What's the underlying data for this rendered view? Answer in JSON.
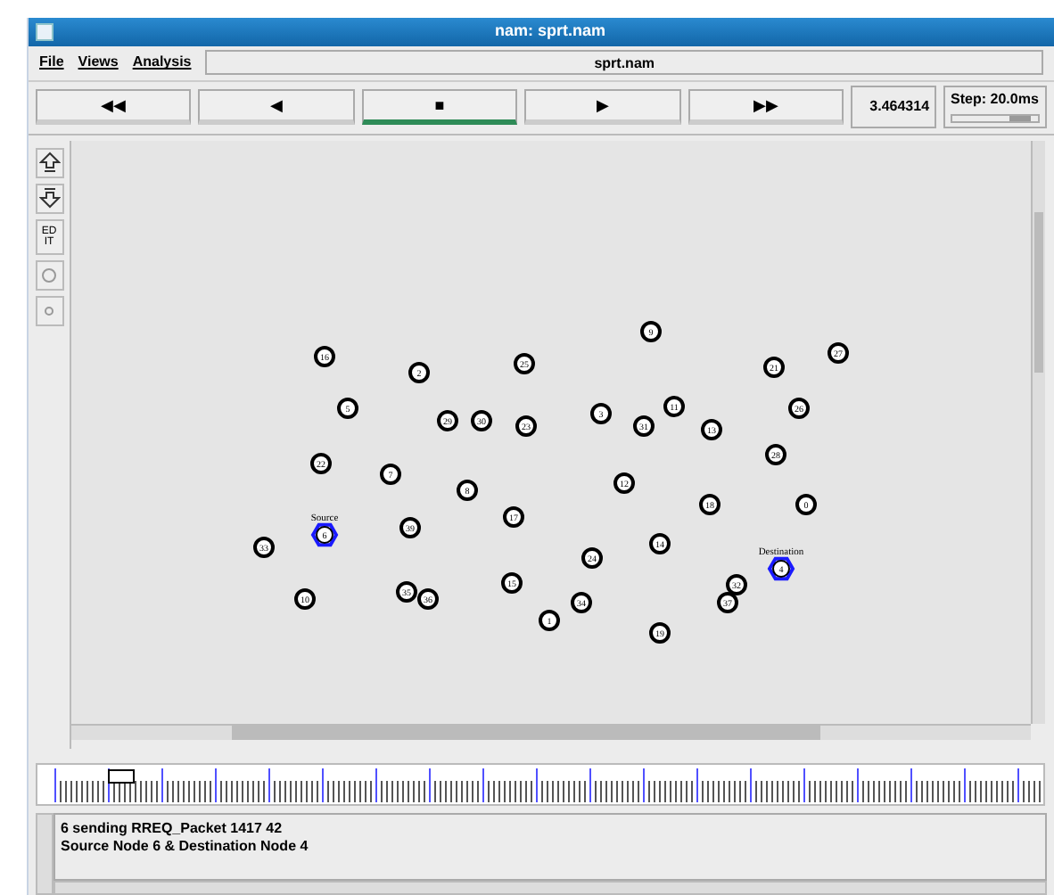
{
  "window": {
    "title": "nam: sprt.nam"
  },
  "menu": [
    "File",
    "Views",
    "Analysis"
  ],
  "file_name": "sprt.nam",
  "playback": [
    {
      "symbol": "◀◀",
      "selected": false
    },
    {
      "symbol": "◀",
      "selected": false
    },
    {
      "symbol": "■",
      "selected": true
    },
    {
      "symbol": "▶",
      "selected": false
    },
    {
      "symbol": "▶▶",
      "selected": false
    }
  ],
  "time": "3.464314",
  "step": {
    "label": "Step: 20.0ms",
    "level": 0.8
  },
  "tools": [
    {
      "kind": "zoom-in"
    },
    {
      "kind": "zoom-out"
    },
    {
      "kind": "edit",
      "text": "ED IT"
    },
    {
      "kind": "circle"
    },
    {
      "kind": "dot"
    }
  ],
  "nodes": [
    {
      "label": "16",
      "kind": "node"
    },
    {
      "label": "2",
      "kind": "node"
    },
    {
      "label": "25",
      "kind": "node"
    },
    {
      "label": "9",
      "kind": "node"
    },
    {
      "label": "21",
      "kind": "node"
    },
    {
      "label": "27",
      "kind": "node"
    },
    {
      "label": "5",
      "kind": "node"
    },
    {
      "label": "29",
      "kind": "node"
    },
    {
      "label": "30",
      "kind": "node"
    },
    {
      "label": "23",
      "kind": "node"
    },
    {
      "label": "3",
      "kind": "node"
    },
    {
      "label": "31",
      "kind": "node"
    },
    {
      "label": "11",
      "kind": "node"
    },
    {
      "label": "13",
      "kind": "node"
    },
    {
      "label": "26",
      "kind": "node"
    },
    {
      "label": "22",
      "kind": "node"
    },
    {
      "label": "7",
      "kind": "node"
    },
    {
      "label": "8",
      "kind": "node"
    },
    {
      "label": "12",
      "kind": "node"
    },
    {
      "label": "28",
      "kind": "node"
    },
    {
      "label": "18",
      "kind": "node"
    },
    {
      "label": "0",
      "kind": "node"
    },
    {
      "label": "17",
      "kind": "node"
    },
    {
      "label": "39",
      "kind": "node"
    },
    {
      "label": "33",
      "kind": "node"
    },
    {
      "label": "6",
      "kind": "endpoint",
      "caption": "Source"
    },
    {
      "label": "14",
      "kind": "node"
    },
    {
      "label": "24",
      "kind": "node"
    },
    {
      "label": "4",
      "kind": "endpoint",
      "caption": "Destination"
    },
    {
      "label": "10",
      "kind": "node"
    },
    {
      "label": "35",
      "kind": "node"
    },
    {
      "label": "36",
      "kind": "node"
    },
    {
      "label": "15",
      "kind": "node"
    },
    {
      "label": "32",
      "kind": "node"
    },
    {
      "label": "34",
      "kind": "node"
    },
    {
      "label": "37",
      "kind": "node"
    },
    {
      "label": "1",
      "kind": "node"
    },
    {
      "label": "19",
      "kind": "node"
    }
  ],
  "log": [
    "6 sending RREQ_Packet 1417 42",
    "Source Node 6 & Destination Node 4"
  ]
}
